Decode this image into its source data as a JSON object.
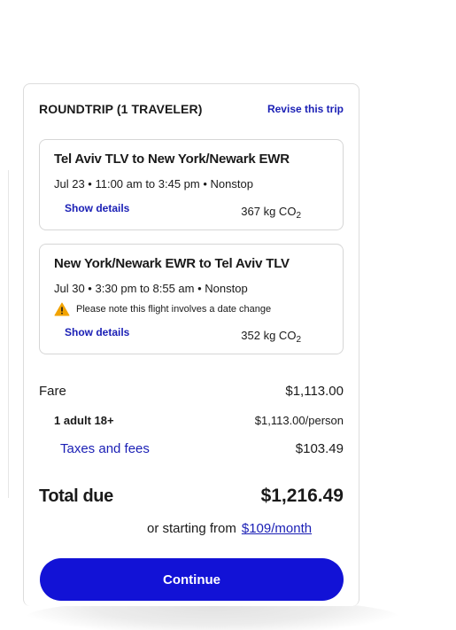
{
  "header": {
    "title": "ROUNDTRIP (1 TRAVELER)",
    "revise_label": "Revise this trip"
  },
  "flights": [
    {
      "route": "Tel Aviv TLV to New York/Newark EWR",
      "schedule": "Jul 23 • 11:00 am to 3:45 pm • Nonstop",
      "details_label": "Show details",
      "co2_value": "367 kg CO",
      "co2_sub": "2"
    },
    {
      "route": "New York/Newark EWR to Tel Aviv TLV",
      "schedule": "Jul 30 • 3:30 pm to 8:55 am • Nonstop",
      "note": "Please note this flight involves a date change",
      "note_icon": "warning-icon",
      "details_label": "Show details",
      "co2_value": "352 kg CO",
      "co2_sub": "2"
    }
  ],
  "pricing": {
    "fare_label": "Fare",
    "fare_value": "$1,113.00",
    "adult_label": "1 adult 18+",
    "adult_value": "$1,113.00/person",
    "taxes_label": "Taxes and fees",
    "taxes_value": "$103.49",
    "total_label": "Total due",
    "total_value": "$1,216.49",
    "monthly_prefix": "or starting from",
    "monthly_link": "$109/month"
  },
  "continue_label": "Continue",
  "colors": {
    "accent": "#1a1fb5",
    "button": "#1212d6",
    "warning": "#f2a300"
  }
}
